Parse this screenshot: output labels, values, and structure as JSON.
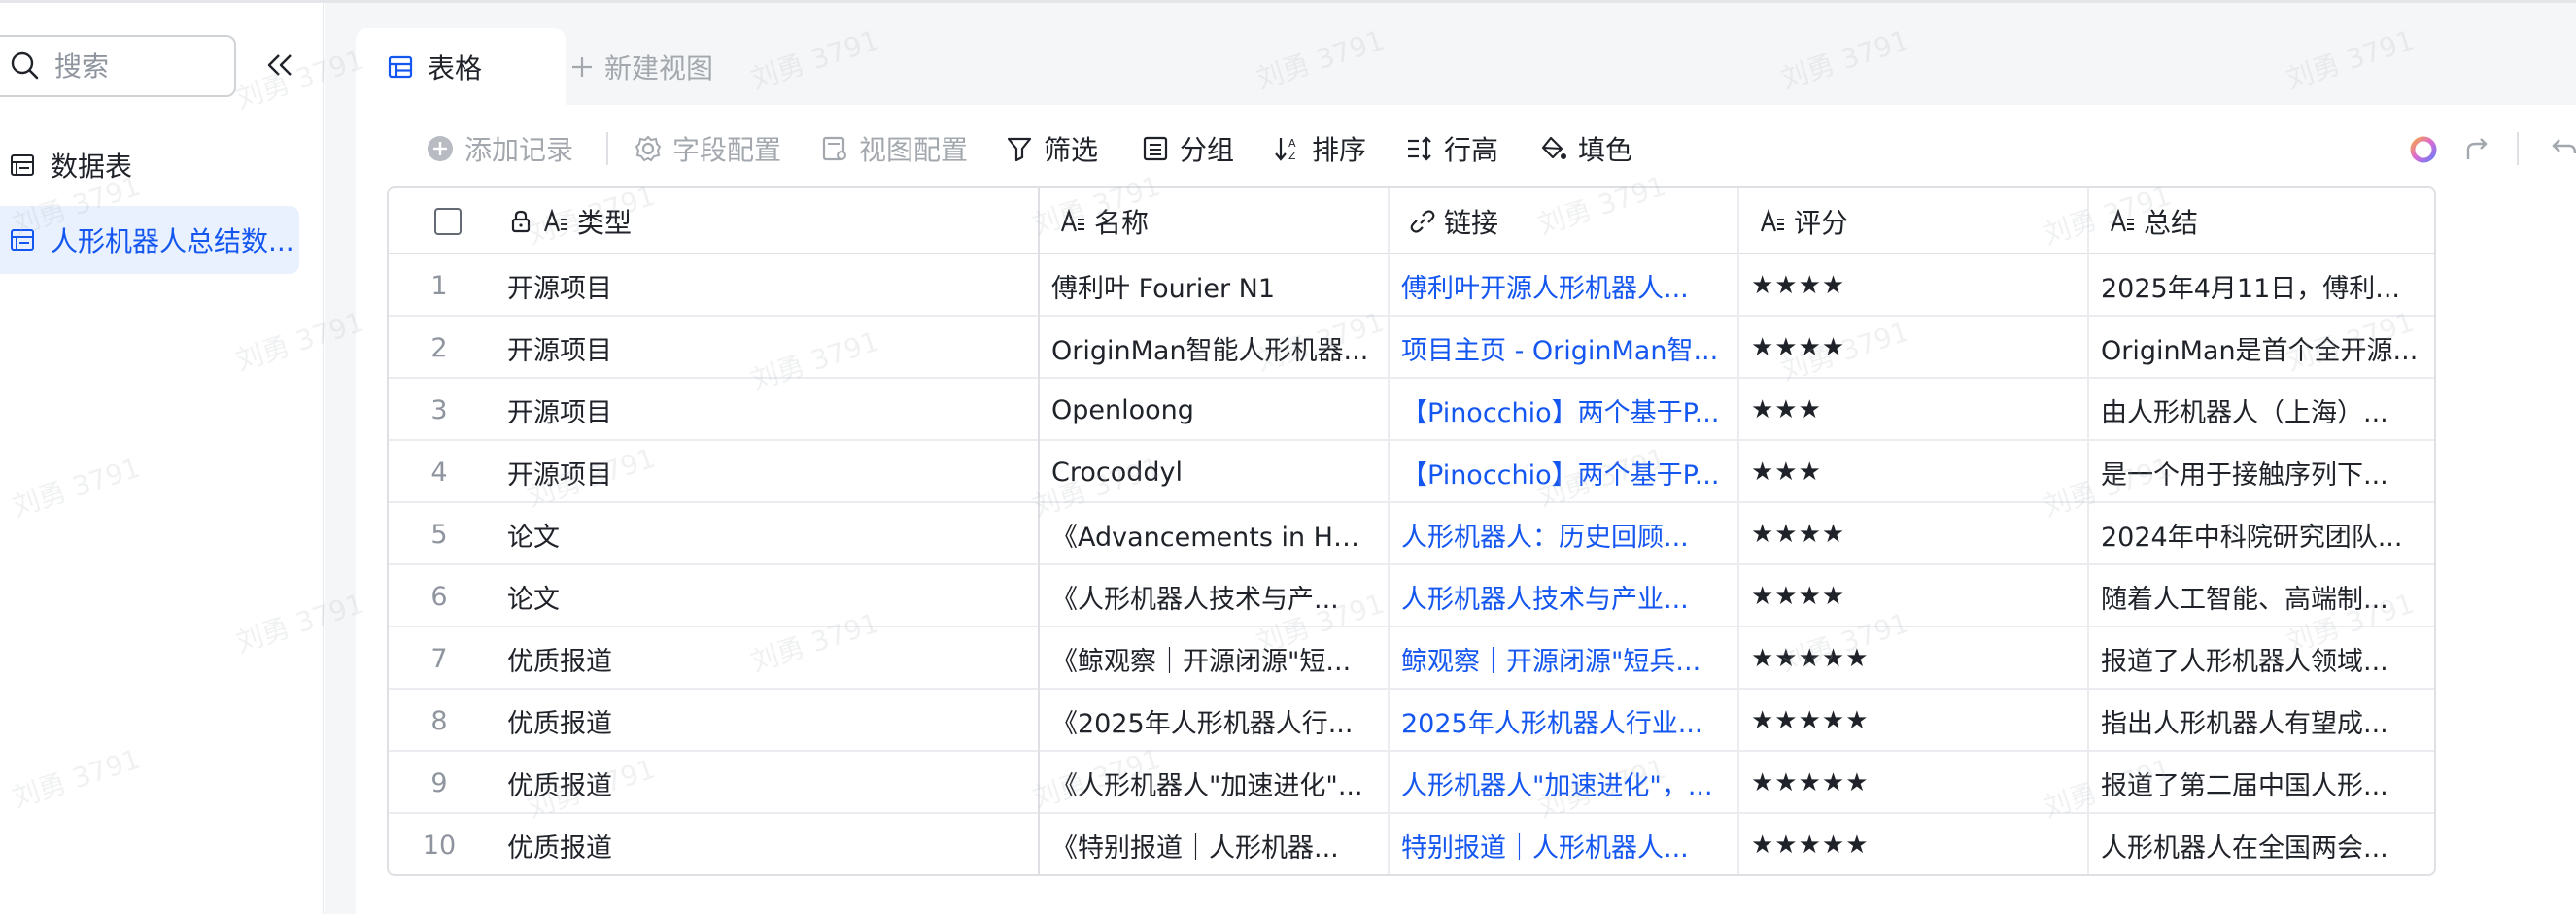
{
  "sidebar": {
    "search": {
      "placeholder": "搜索"
    },
    "items": [
      {
        "label": "数据表"
      },
      {
        "label": "人形机器人总结数..."
      }
    ]
  },
  "tabs": {
    "active_label": "表格",
    "new_view_label": "新建视图"
  },
  "toolbar": {
    "add_record": "添加记录",
    "field_config": "字段配置",
    "view_config": "视图配置",
    "filter": "筛选",
    "group": "分组",
    "sort": "排序",
    "row_height": "行高",
    "fill_color": "填色"
  },
  "table": {
    "columns": [
      "类型",
      "名称",
      "链接",
      "评分",
      "总结"
    ],
    "rows": [
      {
        "n": "1",
        "type": "开源项目",
        "name": "傅利叶 Fourier N1",
        "link": "傅利叶开源人形机器人...",
        "rating": "★★★★",
        "summary": "2025年4月11日，傅利..."
      },
      {
        "n": "2",
        "type": "开源项目",
        "name": "OriginMan智能人形机器...",
        "link": "项目主页 - OriginMan智...",
        "rating": "★★★★",
        "summary": "OriginMan是首个全开源..."
      },
      {
        "n": "3",
        "type": "开源项目",
        "name": "Openloong",
        "link": "【Pinocchio】两个基于P...",
        "rating": "★★★",
        "summary": "由人形机器人（上海）..."
      },
      {
        "n": "4",
        "type": "开源项目",
        "name": "Crocoddyl",
        "link": "【Pinocchio】两个基于P...",
        "rating": "★★★",
        "summary": "是一个用于接触序列下..."
      },
      {
        "n": "5",
        "type": "论文",
        "name": "《Advancements in Hu...",
        "link": "人形机器人：历史回顾...",
        "rating": "★★★★",
        "summary": "2024年中科院研究团队..."
      },
      {
        "n": "6",
        "type": "论文",
        "name": "《人形机器人技术与产...",
        "link": "人形机器人技术与产业...",
        "rating": "★★★★",
        "summary": "随着人工智能、高端制..."
      },
      {
        "n": "7",
        "type": "优质报道",
        "name": "《鲸观察｜开源闭源\"短...",
        "link": "鲸观察｜开源闭源\"短兵...",
        "rating": "★★★★★",
        "summary": "报道了人形机器人领域..."
      },
      {
        "n": "8",
        "type": "优质报道",
        "name": "《2025年人形机器人行...",
        "link": "2025年人形机器人行业...",
        "rating": "★★★★★",
        "summary": "指出人形机器人有望成..."
      },
      {
        "n": "9",
        "type": "优质报道",
        "name": "《人形机器人\"加速进化\"...",
        "link": "人形机器人\"加速进化\"，...",
        "rating": "★★★★★",
        "summary": "报道了第二届中国人形..."
      },
      {
        "n": "10",
        "type": "优质报道",
        "name": "《特别报道｜人形机器...",
        "link": "特别报道｜人形机器人...",
        "rating": "★★★★★",
        "summary": "人形机器人在全国两会..."
      }
    ]
  },
  "watermark_text": "刘勇 3791",
  "colors": {
    "accent": "#1456f0",
    "border": "#dee0e3",
    "muted": "#a3a8ae"
  }
}
